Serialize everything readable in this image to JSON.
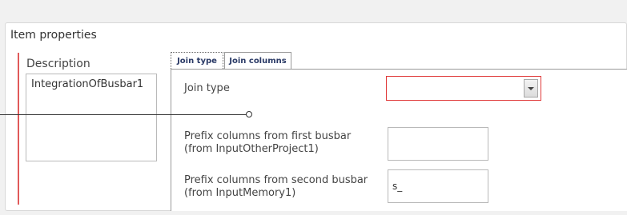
{
  "panel": {
    "title": "Item properties"
  },
  "description": {
    "label": "Description",
    "value": "IntegrationOfBusbar1"
  },
  "tabs": [
    {
      "label": "Join type",
      "active": true
    },
    {
      "label": "Join columns",
      "active": false
    }
  ],
  "join_type": {
    "label": "Join type",
    "selected_value": "",
    "dropdown_icon": "chevron-down-icon"
  },
  "prefix_first": {
    "label_line1": "Prefix columns from first busbar",
    "label_line2": "(from InputOtherProject1)",
    "value": ""
  },
  "prefix_second": {
    "label_line1": "Prefix columns from second busbar",
    "label_line2": "(from InputMemory1)",
    "value": "s_"
  },
  "colors": {
    "error_border": "#e03a3a",
    "accent_rule": "#e15a5a",
    "tab_text": "#2a3a66"
  }
}
